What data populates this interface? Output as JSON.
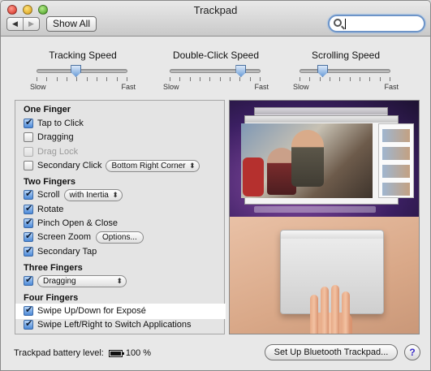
{
  "window": {
    "title": "Trackpad"
  },
  "toolbar": {
    "back_icon": "◀",
    "forward_icon": "▶",
    "show_all_label": "Show All",
    "search": {
      "value": "",
      "placeholder": ""
    }
  },
  "sliders": [
    {
      "label": "Tracking Speed",
      "min_label": "Slow",
      "max_label": "Fast",
      "level_percent": 43
    },
    {
      "label": "Double-Click Speed",
      "min_label": "Slow",
      "max_label": "Fast",
      "level_percent": 78
    },
    {
      "label": "Scrolling Speed",
      "min_label": "Slow",
      "max_label": "Fast",
      "level_percent": 25
    }
  ],
  "one_finger": {
    "heading": "One Finger",
    "tap_to_click": {
      "label": "Tap to Click",
      "checked": true
    },
    "dragging": {
      "label": "Dragging",
      "checked": false
    },
    "drag_lock": {
      "label": "Drag Lock",
      "checked": false,
      "enabled": false
    },
    "secondary_click": {
      "label": "Secondary Click",
      "checked": false,
      "popup_value": "Bottom Right Corner"
    }
  },
  "two_fingers": {
    "heading": "Two Fingers",
    "scroll": {
      "label": "Scroll",
      "checked": true,
      "popup_value": "with Inertia"
    },
    "rotate": {
      "label": "Rotate",
      "checked": true
    },
    "pinch": {
      "label": "Pinch Open & Close",
      "checked": true
    },
    "screen_zoom": {
      "label": "Screen Zoom",
      "checked": true,
      "options_button": "Options..."
    },
    "secondary_tap": {
      "label": "Secondary Tap",
      "checked": true
    }
  },
  "three_fingers": {
    "heading": "Three Fingers",
    "dragging": {
      "checked": true,
      "popup_value": "Dragging"
    }
  },
  "four_fingers": {
    "heading": "Four Fingers",
    "swipe_up_down": {
      "label": "Swipe Up/Down for Exposé",
      "checked": true,
      "selected": true
    },
    "swipe_left_right": {
      "label": "Swipe Left/Right to Switch Applications",
      "checked": true
    }
  },
  "footer": {
    "battery_label": "Trackpad battery level:",
    "battery_value": "100 %",
    "setup_button": "Set Up Bluetooth Trackpad...",
    "help_button": "?"
  }
}
